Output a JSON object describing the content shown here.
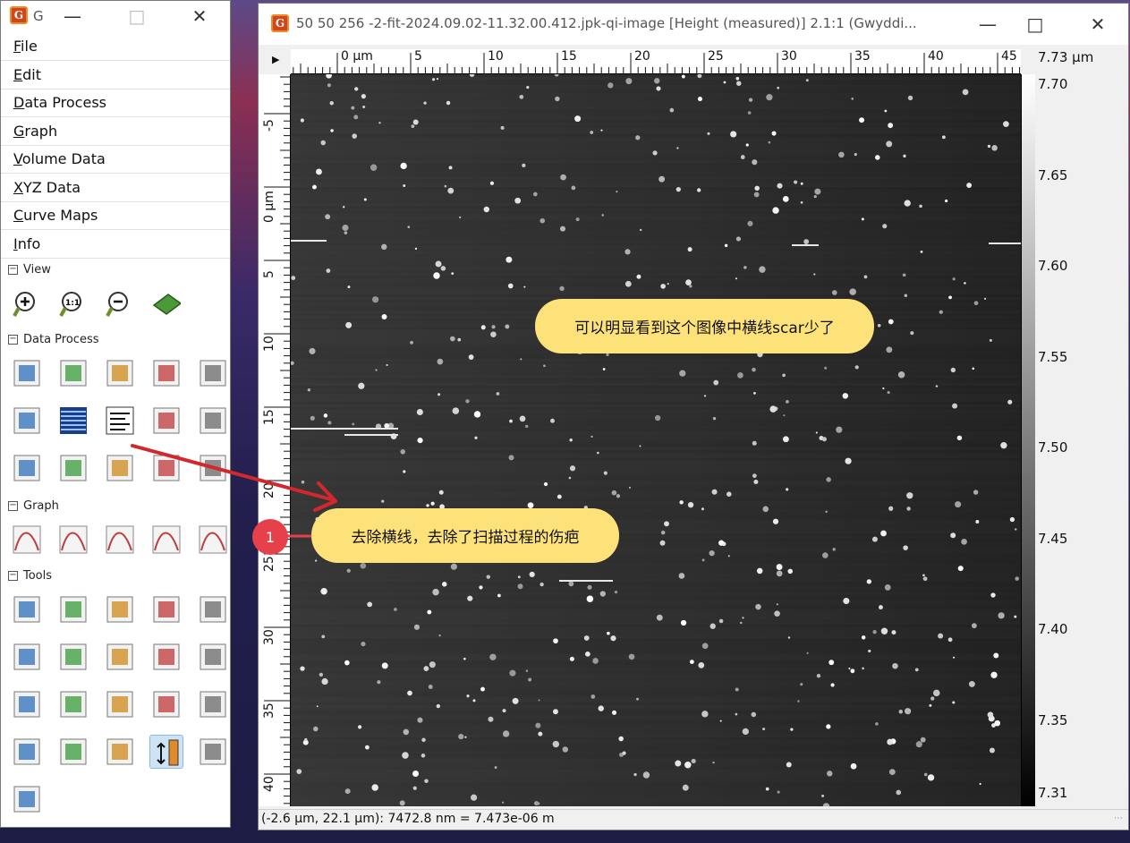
{
  "toolbox": {
    "title_short": "G",
    "menu": [
      "File",
      "Edit",
      "Data Process",
      "Graph",
      "Volume Data",
      "XYZ Data",
      "Curve Maps",
      "Info"
    ],
    "sections": {
      "view": "View",
      "data_process": "Data Process",
      "graph": "Graph",
      "tools": "Tools"
    },
    "view_icons": [
      "zoom-in-icon",
      "zoom-1to1-icon",
      "zoom-out-icon",
      "3d-view-icon"
    ],
    "data_process_icons": [
      "level-icon",
      "crop-icon",
      "scale-icon",
      "duplicate-icon",
      "gradient-icon",
      "facet-icon",
      "align-rows-icon",
      "remove-scars-icon",
      "grains-icon",
      "watershed-icon",
      "mask-icon",
      "statistics-icon",
      "sphere-icon",
      "shade-icon",
      "unmark-icon"
    ],
    "graph_icons": [
      "graph-fit-icon",
      "graph-peaks-icon",
      "graph-cut-icon",
      "graph-align-icon",
      "graph-export-icon"
    ],
    "tools_icons": [
      "pointer-icon",
      "distance-icon",
      "crosshair-icon",
      "profile-icon",
      "radial-profile-icon",
      "slope-icon",
      "stats-icon",
      "level-tool-icon",
      "curve-icon",
      "spectro-icon",
      "ruler-icon",
      "triangle-icon",
      "path-icon",
      "scissors-icon",
      "pencil-icon",
      "blob-icon",
      "grains-mark-icon",
      "delete-icon",
      "color-range-icon",
      "export-icon",
      "xyz-icon"
    ],
    "selected_tool": "color-range-icon"
  },
  "image_window": {
    "title": "50 50 256 -2-fit-2024.09.02-11.32.00.412.jpk-qi-image [Height (measured)] 2.1:1 (Gwyddi...",
    "h_ruler_unit_label": "0 µm",
    "h_ruler_labels": [
      "5",
      "10",
      "15",
      "20",
      "25",
      "30",
      "35",
      "40",
      "45"
    ],
    "v_ruler_labels": [
      "-5",
      "0 µm",
      "5",
      "10",
      "15",
      "20",
      "25",
      "30",
      "35",
      "40"
    ],
    "colorbar_max": "7.73 µm",
    "colorbar_labels": [
      "7.70",
      "7.65",
      "7.60",
      "7.55",
      "7.50",
      "7.45",
      "7.40",
      "7.35",
      "7.31"
    ],
    "status": "(-2.6 µm, 22.1 µm): 7472.8 nm = 7.473e-06 m"
  },
  "annotations": {
    "top_bubble": "可以明显看到这个图像中横线scar少了",
    "step_number": "1",
    "bottom_bubble": "去除横线，去除了扫描过程的伤疤"
  },
  "colors": {
    "bubble": "#fde27a",
    "marker": "#e6414a",
    "arrow": "#d2282d",
    "highlight": "#cde4f7"
  }
}
